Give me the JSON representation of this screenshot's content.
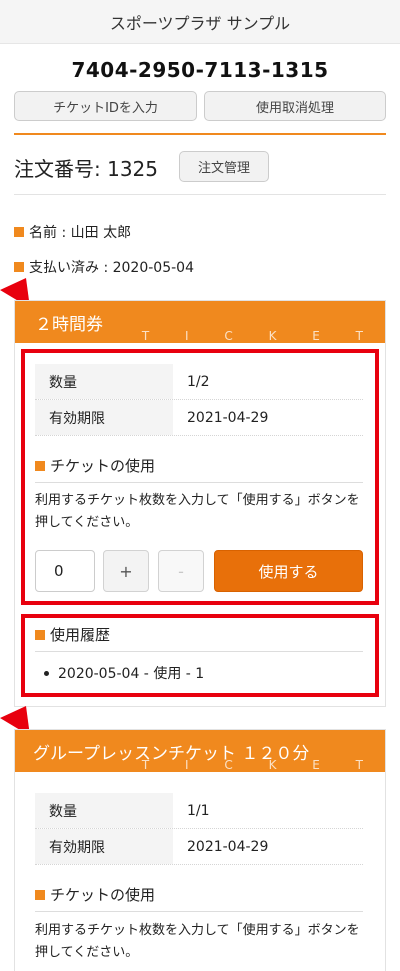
{
  "header": {
    "title": "スポーツプラザ サンプル"
  },
  "ticket_id": "7404-2950-7113-1315",
  "actions": {
    "enter_ticket_id": "チケットIDを入力",
    "cancel_use": "使用取消処理"
  },
  "order": {
    "label": "注文番号: 1325",
    "manage_button": "注文管理"
  },
  "customer": {
    "name": "名前 : 山田 太郎",
    "payment": "支払い済み : 2020-05-04"
  },
  "tickets": [
    {
      "name": "２時間券",
      "badge": "T I C K E T",
      "rows": [
        {
          "key": "数量",
          "value": "1/2"
        },
        {
          "key": "有効期限",
          "value": "2021-04-29"
        }
      ],
      "use_title": "チケットの使用",
      "use_desc": "利用するチケット枚数を入力して「使用する」ボタンを押してください。",
      "qty": "0",
      "plus": "+",
      "minus": "-",
      "use_button": "使用する",
      "history_title": "使用履歴",
      "history": [
        "2020-05-04 - 使用 - 1"
      ]
    },
    {
      "name": "グループレッスンチケット １２０分",
      "badge": "T I C K E T",
      "rows": [
        {
          "key": "数量",
          "value": "1/1"
        },
        {
          "key": "有効期限",
          "value": "2021-04-29"
        }
      ],
      "use_title": "チケットの使用",
      "use_desc": "利用するチケット枚数を入力して「使用する」ボタンを押してください。"
    }
  ],
  "colors": {
    "accent": "#f0891e",
    "use_button": "#e8700a",
    "highlight": "#e8000e"
  }
}
